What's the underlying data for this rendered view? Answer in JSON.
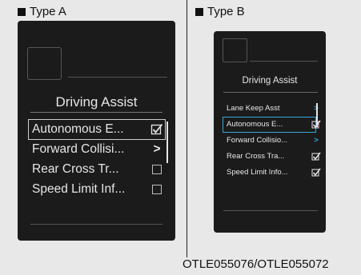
{
  "type_a": {
    "label": "Type A",
    "menu_title": "Driving Assist",
    "items": [
      {
        "label": "Autonomous E...",
        "control": "checkbox",
        "checked": true,
        "selected": true
      },
      {
        "label": "Forward Collisi...",
        "control": "chevron",
        "checked": false,
        "selected": false
      },
      {
        "label": "Rear Cross Tr...",
        "control": "checkbox",
        "checked": false,
        "selected": false
      },
      {
        "label": "Speed Limit Inf...",
        "control": "checkbox",
        "checked": false,
        "selected": false
      }
    ]
  },
  "type_b": {
    "label": "Type B",
    "menu_title": "Driving Assist",
    "items": [
      {
        "label": "Lane Keep Asst",
        "control": "chevron",
        "checked": false,
        "selected": false
      },
      {
        "label": "Autonomous E...",
        "control": "checkbox",
        "checked": true,
        "selected": true
      },
      {
        "label": "Forward Collisio...",
        "control": "chevron",
        "checked": false,
        "selected": false
      },
      {
        "label": "Rear Cross Tra...",
        "control": "checkbox",
        "checked": true,
        "selected": false
      },
      {
        "label": "Speed Limit Info...",
        "control": "checkbox",
        "checked": true,
        "selected": false
      }
    ]
  },
  "caption": "OTLE055076/OTLE055072",
  "colors": {
    "screen_bg": "#1b1b1b",
    "accent": "#38a6d6",
    "text": "#e6e6e6"
  }
}
